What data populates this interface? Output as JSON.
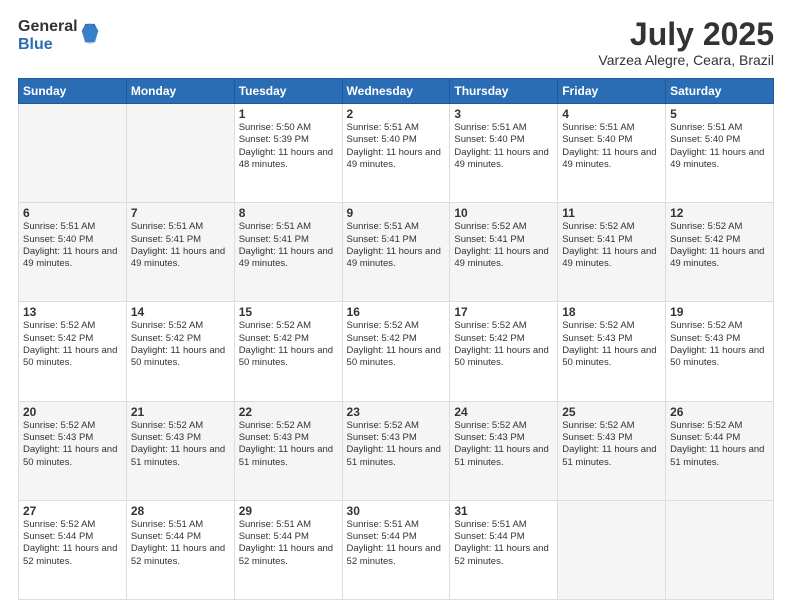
{
  "logo": {
    "general": "General",
    "blue": "Blue"
  },
  "header": {
    "month": "July 2025",
    "location": "Varzea Alegre, Ceara, Brazil"
  },
  "weekdays": [
    "Sunday",
    "Monday",
    "Tuesday",
    "Wednesday",
    "Thursday",
    "Friday",
    "Saturday"
  ],
  "weeks": [
    [
      {
        "day": "",
        "info": ""
      },
      {
        "day": "",
        "info": ""
      },
      {
        "day": "1",
        "info": "Sunrise: 5:50 AM\nSunset: 5:39 PM\nDaylight: 11 hours and 48 minutes."
      },
      {
        "day": "2",
        "info": "Sunrise: 5:51 AM\nSunset: 5:40 PM\nDaylight: 11 hours and 49 minutes."
      },
      {
        "day": "3",
        "info": "Sunrise: 5:51 AM\nSunset: 5:40 PM\nDaylight: 11 hours and 49 minutes."
      },
      {
        "day": "4",
        "info": "Sunrise: 5:51 AM\nSunset: 5:40 PM\nDaylight: 11 hours and 49 minutes."
      },
      {
        "day": "5",
        "info": "Sunrise: 5:51 AM\nSunset: 5:40 PM\nDaylight: 11 hours and 49 minutes."
      }
    ],
    [
      {
        "day": "6",
        "info": "Sunrise: 5:51 AM\nSunset: 5:40 PM\nDaylight: 11 hours and 49 minutes."
      },
      {
        "day": "7",
        "info": "Sunrise: 5:51 AM\nSunset: 5:41 PM\nDaylight: 11 hours and 49 minutes."
      },
      {
        "day": "8",
        "info": "Sunrise: 5:51 AM\nSunset: 5:41 PM\nDaylight: 11 hours and 49 minutes."
      },
      {
        "day": "9",
        "info": "Sunrise: 5:51 AM\nSunset: 5:41 PM\nDaylight: 11 hours and 49 minutes."
      },
      {
        "day": "10",
        "info": "Sunrise: 5:52 AM\nSunset: 5:41 PM\nDaylight: 11 hours and 49 minutes."
      },
      {
        "day": "11",
        "info": "Sunrise: 5:52 AM\nSunset: 5:41 PM\nDaylight: 11 hours and 49 minutes."
      },
      {
        "day": "12",
        "info": "Sunrise: 5:52 AM\nSunset: 5:42 PM\nDaylight: 11 hours and 49 minutes."
      }
    ],
    [
      {
        "day": "13",
        "info": "Sunrise: 5:52 AM\nSunset: 5:42 PM\nDaylight: 11 hours and 50 minutes."
      },
      {
        "day": "14",
        "info": "Sunrise: 5:52 AM\nSunset: 5:42 PM\nDaylight: 11 hours and 50 minutes."
      },
      {
        "day": "15",
        "info": "Sunrise: 5:52 AM\nSunset: 5:42 PM\nDaylight: 11 hours and 50 minutes."
      },
      {
        "day": "16",
        "info": "Sunrise: 5:52 AM\nSunset: 5:42 PM\nDaylight: 11 hours and 50 minutes."
      },
      {
        "day": "17",
        "info": "Sunrise: 5:52 AM\nSunset: 5:42 PM\nDaylight: 11 hours and 50 minutes."
      },
      {
        "day": "18",
        "info": "Sunrise: 5:52 AM\nSunset: 5:43 PM\nDaylight: 11 hours and 50 minutes."
      },
      {
        "day": "19",
        "info": "Sunrise: 5:52 AM\nSunset: 5:43 PM\nDaylight: 11 hours and 50 minutes."
      }
    ],
    [
      {
        "day": "20",
        "info": "Sunrise: 5:52 AM\nSunset: 5:43 PM\nDaylight: 11 hours and 50 minutes."
      },
      {
        "day": "21",
        "info": "Sunrise: 5:52 AM\nSunset: 5:43 PM\nDaylight: 11 hours and 51 minutes."
      },
      {
        "day": "22",
        "info": "Sunrise: 5:52 AM\nSunset: 5:43 PM\nDaylight: 11 hours and 51 minutes."
      },
      {
        "day": "23",
        "info": "Sunrise: 5:52 AM\nSunset: 5:43 PM\nDaylight: 11 hours and 51 minutes."
      },
      {
        "day": "24",
        "info": "Sunrise: 5:52 AM\nSunset: 5:43 PM\nDaylight: 11 hours and 51 minutes."
      },
      {
        "day": "25",
        "info": "Sunrise: 5:52 AM\nSunset: 5:43 PM\nDaylight: 11 hours and 51 minutes."
      },
      {
        "day": "26",
        "info": "Sunrise: 5:52 AM\nSunset: 5:44 PM\nDaylight: 11 hours and 51 minutes."
      }
    ],
    [
      {
        "day": "27",
        "info": "Sunrise: 5:52 AM\nSunset: 5:44 PM\nDaylight: 11 hours and 52 minutes."
      },
      {
        "day": "28",
        "info": "Sunrise: 5:51 AM\nSunset: 5:44 PM\nDaylight: 11 hours and 52 minutes."
      },
      {
        "day": "29",
        "info": "Sunrise: 5:51 AM\nSunset: 5:44 PM\nDaylight: 11 hours and 52 minutes."
      },
      {
        "day": "30",
        "info": "Sunrise: 5:51 AM\nSunset: 5:44 PM\nDaylight: 11 hours and 52 minutes."
      },
      {
        "day": "31",
        "info": "Sunrise: 5:51 AM\nSunset: 5:44 PM\nDaylight: 11 hours and 52 minutes."
      },
      {
        "day": "",
        "info": ""
      },
      {
        "day": "",
        "info": ""
      }
    ]
  ]
}
